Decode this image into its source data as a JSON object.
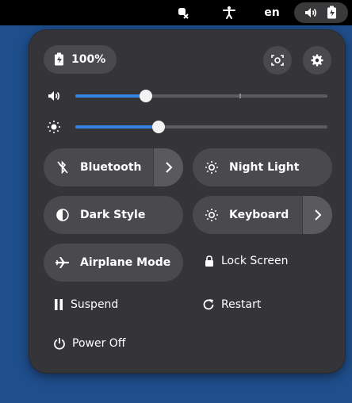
{
  "topbar": {
    "language": "en"
  },
  "menu": {
    "battery_label": "100%",
    "tiles": {
      "bluetooth": "Bluetooth",
      "night_light": "Night Light",
      "dark_style": "Dark Style",
      "keyboard": "Keyboard",
      "airplane_mode": "Airplane Mode"
    },
    "actions": {
      "lock_screen": "Lock Screen",
      "suspend": "Suspend",
      "restart": "Restart",
      "power_off": "Power Off"
    },
    "sliders": {
      "volume_level": 0.28,
      "volume_max_mark": 0.65,
      "brightness_level": 0.33
    }
  },
  "colors": {
    "accent": "#3584e4",
    "menu_bg": "#353539",
    "tile_bg": "#4a4a4e",
    "desktop_bg": "#1f4e8c"
  }
}
